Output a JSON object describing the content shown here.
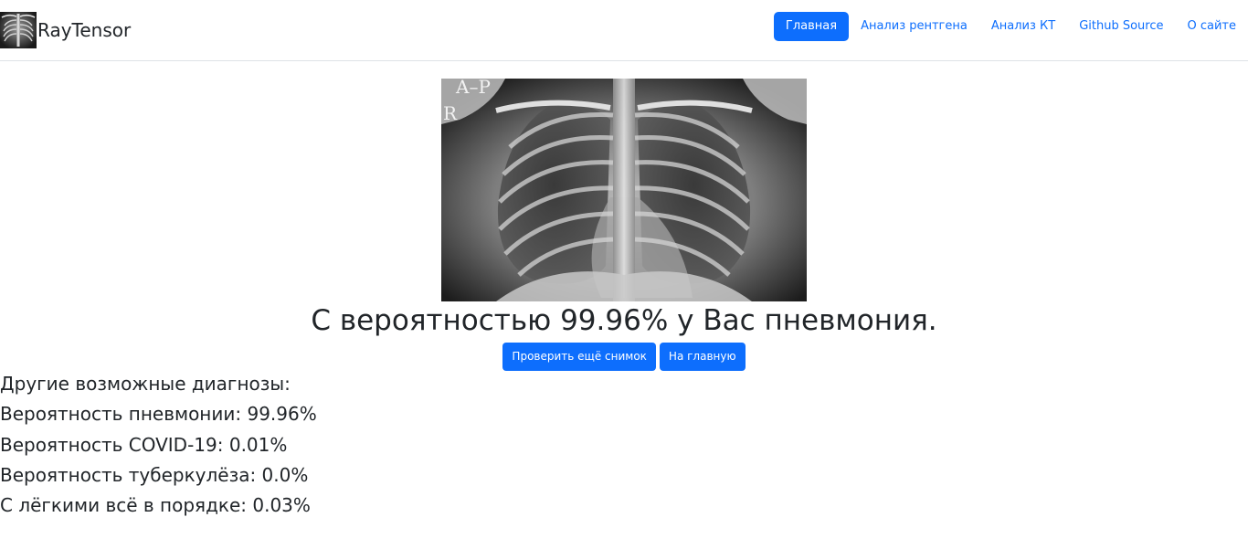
{
  "navbar": {
    "brand_name": "RayTensor",
    "logo_icon": "chest-xray-logo-icon",
    "links": [
      {
        "label": "Главная",
        "active": true
      },
      {
        "label": "Анализ рентгена",
        "active": false
      },
      {
        "label": "Анализ КТ",
        "active": false
      },
      {
        "label": "Github Source",
        "active": false
      },
      {
        "label": "О сайте",
        "active": false
      }
    ]
  },
  "xray_image": {
    "marker_top": "A–P",
    "marker_side": "R"
  },
  "result": {
    "title": "С вероятностью 99.96% у Вас пневмония."
  },
  "actions": {
    "check_again": "Проверить ещё снимок",
    "home": "На главную"
  },
  "diagnoses": {
    "heading": "Другие возможные диагнозы:",
    "items": [
      "Вероятность пневмонии: 99.96%",
      "Вероятность COVID-19: 0.01%",
      "Вероятность туберкулёза: 0.0%",
      "С лёгкими всё в порядке: 0.03%"
    ]
  },
  "colors": {
    "primary": "#0d6efd",
    "text": "#212529",
    "border": "#dee2e6"
  }
}
